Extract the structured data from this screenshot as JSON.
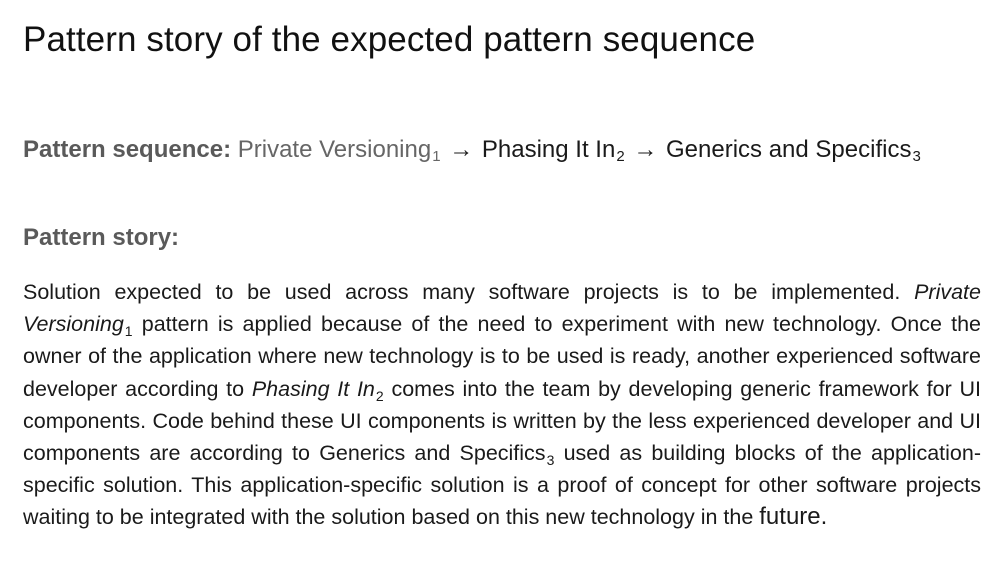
{
  "title": "Pattern story of the expected pattern sequence",
  "sequence": {
    "label": "Pattern sequence:",
    "items": [
      {
        "name": "Private Versioning",
        "index": "1"
      },
      {
        "name": "Phasing It In",
        "index": "2"
      },
      {
        "name": "Generics and Specifics",
        "index": "3"
      }
    ],
    "arrow": "→"
  },
  "story": {
    "label": "Pattern story:",
    "p1": "Solution expected to be used across many software projects is to be implemented. ",
    "ref1_name": "Private Versioning",
    "ref1_index": "1",
    "p2": " pattern is applied because of the need to experiment with new technology. Once the owner of the application where new technology is to be used is ready, another experienced software developer according to ",
    "ref2_name": "Phasing It In",
    "ref2_index": "2",
    "p3": " comes into the team by developing generic framework for UI components. Code behind these UI components is written by the less experienced developer and UI components are according to Generics and Specifics",
    "ref3_index": "3",
    "p4": " used as building blocks of the application-specific solution. This application-specific solution is a proof of concept for other software projects waiting to be integrated with the solution based on this new technology in the ",
    "last_word": "future."
  }
}
